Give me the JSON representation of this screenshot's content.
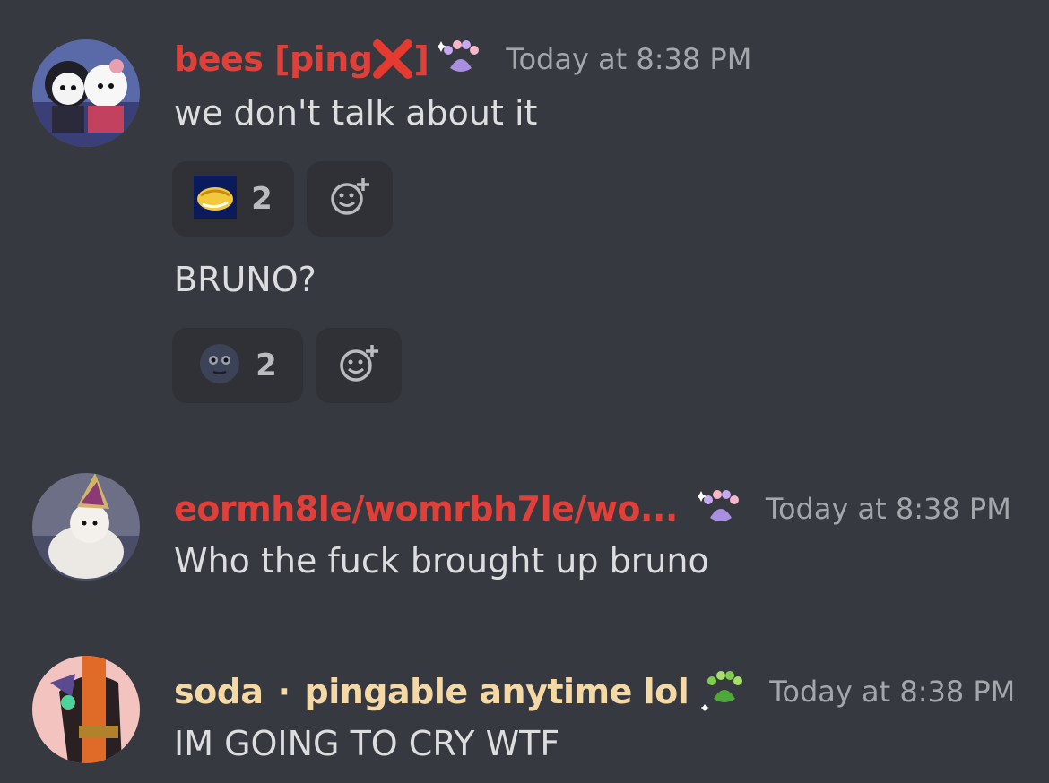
{
  "messages": [
    {
      "username_prefix": "bees [ping ",
      "username_suffix": "]",
      "username_color": "#e0403a",
      "timestamp": "Today at 8:38 PM",
      "text": "we don't talk about it",
      "reactions": [
        {
          "emoji": "bread-emoji",
          "count": "2"
        }
      ],
      "followup_text": "BRUNO?",
      "followup_reactions": [
        {
          "emoji": "new-moon-face-emoji",
          "count": "2"
        }
      ]
    },
    {
      "username": "eormh8le/womrbh7le/wo...",
      "username_color": "#e0403a",
      "timestamp": "Today at 8:38 PM",
      "text": "Who the fuck brought up bruno"
    },
    {
      "username": "soda",
      "separator": "·",
      "username_tail": "pingable anytime lol",
      "username_color": "#f4d9a6",
      "timestamp": "Today at 8:38 PM",
      "text": "IM GOING TO CRY WTF"
    }
  ],
  "colors": {
    "background": "#36393f",
    "reaction_bg": "#2f3136",
    "timestamp": "#a3a6aa",
    "text": "#dcddde"
  }
}
